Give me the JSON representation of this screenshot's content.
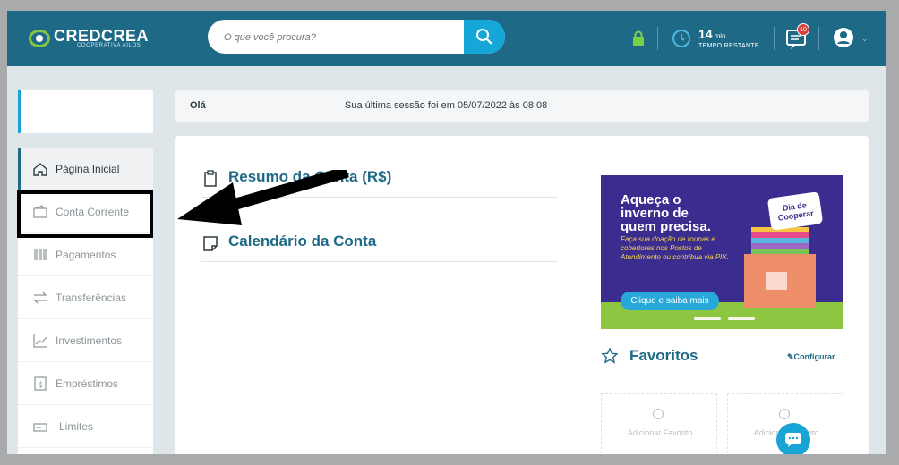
{
  "header": {
    "logo_text": "CREDCREA",
    "logo_sub": "COOPERATIVA AILOS",
    "search_placeholder": "O que você procura?",
    "timer_value": "14",
    "timer_unit": "min",
    "timer_label": "TEMPO RESTANTE",
    "notification_count": "10",
    "icons": [
      "search-icon",
      "lock-icon",
      "clock-icon",
      "message-icon",
      "user-icon",
      "chevron-down-icon"
    ]
  },
  "greeting": {
    "hello": "Olá",
    "last_session": "Sua última sessão foi em 05/07/2022 às 08:08"
  },
  "sidebar": {
    "items": [
      {
        "label": "Página Inicial",
        "icon": "home-icon"
      },
      {
        "label": "Conta Corrente",
        "icon": "wallet-icon"
      },
      {
        "label": "Pagamentos",
        "icon": "barcode-icon"
      },
      {
        "label": "Transferências",
        "icon": "transfer-icon"
      },
      {
        "label": "Investimentos",
        "icon": "chart-icon"
      },
      {
        "label": "Empréstimos",
        "icon": "loan-icon"
      },
      {
        "label": "Limites",
        "icon": "limits-icon"
      }
    ]
  },
  "main": {
    "summary_title": "Resumo da Conta (R$)",
    "calendar_title": "Calendário da Conta",
    "banner": {
      "headline": "Aqueça o inverno de quem precisa.",
      "subtext": "Faça sua doação de roupas e cobertores nos Postos de Atendimento ou contribua via PIX.",
      "cta": "Clique e saiba mais",
      "tag": "Dia de Cooperar"
    },
    "favorites_title": "Favoritos",
    "configure_label": "Configurar",
    "favorite_placeholder": "Adicionar Favorito"
  },
  "colors": {
    "brand": "#1e6a86",
    "accent": "#19a4d6"
  }
}
